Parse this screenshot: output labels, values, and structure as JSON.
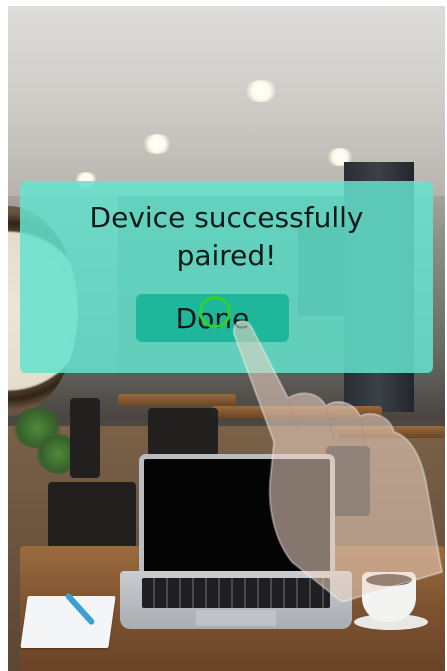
{
  "dialog": {
    "message": "Device successfully\npaired!",
    "done_label": "Done"
  },
  "colors": {
    "dialog_background": "#64e2cd",
    "button_background": "#1fb79b",
    "tap_indicator": "#2fd02f"
  },
  "icons": {
    "tap_indicator": "tap-ring-icon",
    "hand": "pointing-hand-icon"
  }
}
